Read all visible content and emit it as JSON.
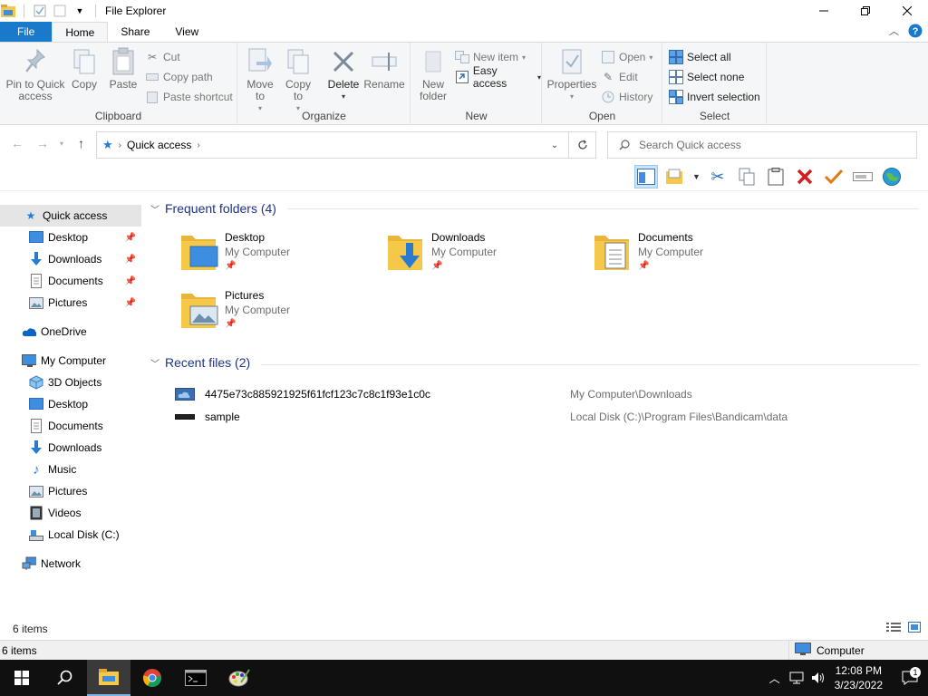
{
  "window": {
    "title": "File Explorer"
  },
  "tabs": [
    {
      "label": "File"
    },
    {
      "label": "Home"
    },
    {
      "label": "Share"
    },
    {
      "label": "View"
    }
  ],
  "ribbon": {
    "clipboard": {
      "label": "Clipboard",
      "pin": "Pin to Quick access",
      "copy": "Copy",
      "paste": "Paste",
      "cut": "Cut",
      "copy_path": "Copy path",
      "paste_shortcut": "Paste shortcut"
    },
    "organize": {
      "label": "Organize",
      "move_to": "Move to",
      "copy_to": "Copy to",
      "delete": "Delete",
      "rename": "Rename"
    },
    "new": {
      "label": "New",
      "new_folder": "New folder",
      "new_item": "New item",
      "easy_access": "Easy access"
    },
    "open": {
      "label": "Open",
      "properties": "Properties",
      "open": "Open",
      "edit": "Edit",
      "history": "History"
    },
    "select": {
      "label": "Select",
      "select_all": "Select all",
      "select_none": "Select none",
      "invert": "Invert selection"
    }
  },
  "address": {
    "crumb": "Quick access"
  },
  "search": {
    "placeholder": "Search Quick access"
  },
  "nav": {
    "quick_access": "Quick access",
    "qa_items": [
      "Desktop",
      "Downloads",
      "Documents",
      "Pictures"
    ],
    "onedrive": "OneDrive",
    "my_computer": "My Computer",
    "pc_items": [
      "3D Objects",
      "Desktop",
      "Documents",
      "Downloads",
      "Music",
      "Pictures",
      "Videos",
      "Local Disk (C:)"
    ],
    "network": "Network"
  },
  "content": {
    "frequent_header": "Frequent folders (4)",
    "folders": [
      {
        "name": "Desktop",
        "location": "My Computer"
      },
      {
        "name": "Downloads",
        "location": "My Computer"
      },
      {
        "name": "Documents",
        "location": "My Computer"
      },
      {
        "name": "Pictures",
        "location": "My Computer"
      }
    ],
    "recent_header": "Recent files (2)",
    "recent": [
      {
        "name": "4475e73c885921925f61fcf123c7c8c1f93e1c0c",
        "path": "My Computer\\Downloads"
      },
      {
        "name": "sample",
        "path": "Local Disk (C:)\\Program Files\\Bandicam\\data"
      }
    ]
  },
  "status": {
    "count": "6 items",
    "count2": "6 items",
    "computer": "Computer"
  },
  "taskbar": {
    "time": "12:08 PM",
    "date": "3/23/2022",
    "notifications": "1"
  },
  "colors": {
    "accent": "#1979ca",
    "folder": "#f5c84a",
    "header_text": "#1e3287",
    "taskbar": "#101010"
  }
}
